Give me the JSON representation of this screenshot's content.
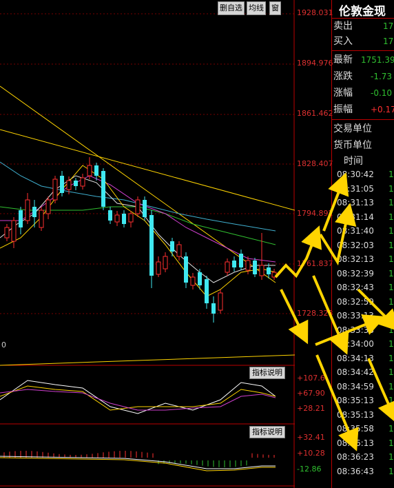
{
  "toolbar": {
    "delete_select": "删自选",
    "ma": "均线",
    "window": "窗"
  },
  "price_axis": [
    "1928.031",
    "1894.976",
    "1861.462",
    "1828.407",
    "1794.892",
    "1761.837",
    "1728.323"
  ],
  "left_edge_label": "0",
  "indicator1": {
    "button": "指标说明",
    "ticks": [
      "+107.6",
      "+67.90",
      "+28.21"
    ]
  },
  "indicator2": {
    "button": "指标说明",
    "ticks": [
      "+32.41",
      "+10.28",
      "-12.86"
    ]
  },
  "quote": {
    "title": "伦敦金现",
    "sell_label": "卖出",
    "sell_value": "17",
    "buy_label": "买入",
    "buy_value": "17",
    "last_label": "最新",
    "last_value": "1751.39",
    "change_label": "涨跌",
    "change_value": "-1.73",
    "pct_label": "涨幅",
    "pct_value": "-0.10",
    "amp_label": "振幅",
    "amp_value": "+0.17",
    "trade_unit_label": "交易单位",
    "currency_unit_label": "货币单位",
    "time_header": "时间"
  },
  "ticks": [
    {
      "t": "08:30:42",
      "v": "1"
    },
    {
      "t": "08:31:05",
      "v": "1"
    },
    {
      "t": "08:31:13",
      "v": "1"
    },
    {
      "t": "08:31:14",
      "v": "1"
    },
    {
      "t": "08:31:40",
      "v": "1"
    },
    {
      "t": "08:32:03",
      "v": "1"
    },
    {
      "t": "08:32:13",
      "v": "1"
    },
    {
      "t": "08:32:39",
      "v": "1"
    },
    {
      "t": "08:32:43",
      "v": "1"
    },
    {
      "t": "08:32:59",
      "v": "1"
    },
    {
      "t": "08:33:13",
      "v": "1"
    },
    {
      "t": "08:33:38",
      "v": "1"
    },
    {
      "t": "08:34:00",
      "v": "1"
    },
    {
      "t": "08:34:13",
      "v": "1"
    },
    {
      "t": "08:34:42",
      "v": "1"
    },
    {
      "t": "08:34:59",
      "v": "1"
    },
    {
      "t": "08:35:13",
      "v": "1"
    },
    {
      "t": "08:35:13",
      "v": "1"
    },
    {
      "t": "08:35:58",
      "v": "1"
    },
    {
      "t": "08:36:13",
      "v": "1"
    },
    {
      "t": "08:36:23",
      "v": "1"
    },
    {
      "t": "08:36:43",
      "v": "1"
    }
  ],
  "colors": {
    "up": "#ff3030",
    "down": "#40e8f0",
    "accent": "#ffd400",
    "grid": "#a00000"
  }
}
